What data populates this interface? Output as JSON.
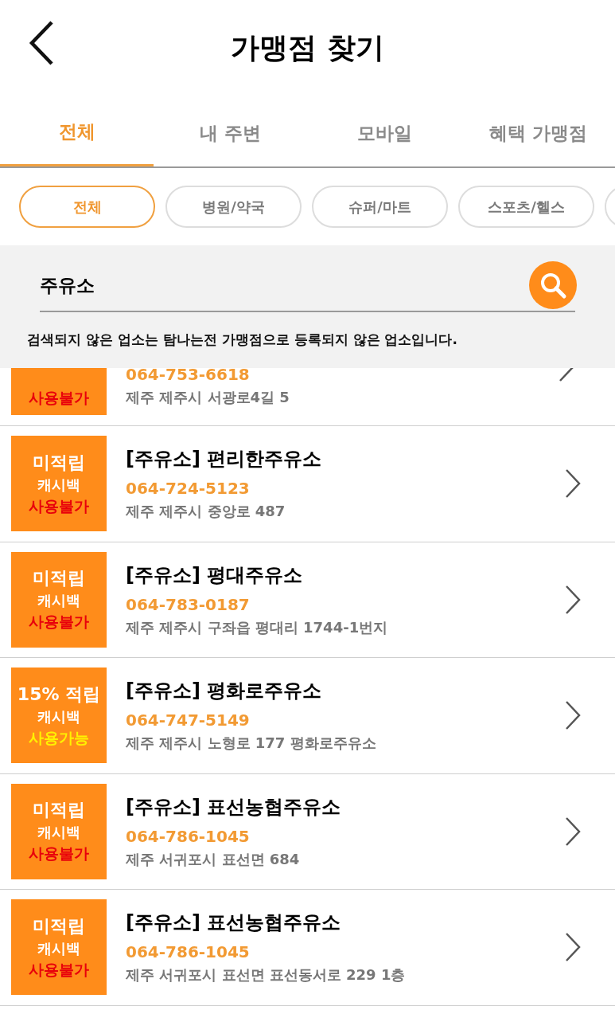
{
  "header": {
    "title": "가맹점 찾기"
  },
  "tabs": [
    {
      "label": "전체",
      "selected": true
    },
    {
      "label": "내 주변",
      "selected": false
    },
    {
      "label": "모바일",
      "selected": false
    },
    {
      "label": "혜택 가맹점",
      "selected": false
    }
  ],
  "chips": [
    {
      "label": "전체",
      "selected": true
    },
    {
      "label": "병원/약국",
      "selected": false
    },
    {
      "label": "슈퍼/마트",
      "selected": false
    },
    {
      "label": "스포츠/헬스",
      "selected": false
    }
  ],
  "search": {
    "value": "주유소"
  },
  "notice": "검색되지 않은 업소는 탐나는전 가맹점으로 등록되지 않은 업소입니다.",
  "stores": [
    {
      "kind": "partial",
      "phone": "064-753-6618",
      "address": "제주 제주시 서광로4길 5",
      "status": "사용불가",
      "usable": false
    },
    {
      "kind": "full",
      "reward": "미적립",
      "cashback": "캐시백",
      "status": "사용불가",
      "usable": false,
      "name": "[주유소] 편리한주유소",
      "phone": "064-724-5123",
      "address": "제주 제주시 중앙로 487"
    },
    {
      "kind": "full",
      "reward": "미적립",
      "cashback": "캐시백",
      "status": "사용불가",
      "usable": false,
      "name": "[주유소] 평대주유소",
      "phone": "064-783-0187",
      "address": "제주 제주시 구좌읍 평대리 1744-1번지"
    },
    {
      "kind": "full",
      "reward": "15% 적립",
      "cashback": "캐시백",
      "status": "사용가능",
      "usable": true,
      "name": "[주유소] 평화로주유소",
      "phone": "064-747-5149",
      "address": "제주 제주시 노형로 177 평화로주유소"
    },
    {
      "kind": "full",
      "reward": "미적립",
      "cashback": "캐시백",
      "status": "사용불가",
      "usable": false,
      "name": "[주유소] 표선농협주유소",
      "phone": "064-786-1045",
      "address": "제주 서귀포시 표선면 684"
    },
    {
      "kind": "full",
      "reward": "미적립",
      "cashback": "캐시백",
      "status": "사용불가",
      "usable": false,
      "name": "[주유소] 표선농협주유소",
      "phone": "064-786-1045",
      "address": "제주 서귀포시 표선면 표선동서로 229 1층"
    }
  ]
}
